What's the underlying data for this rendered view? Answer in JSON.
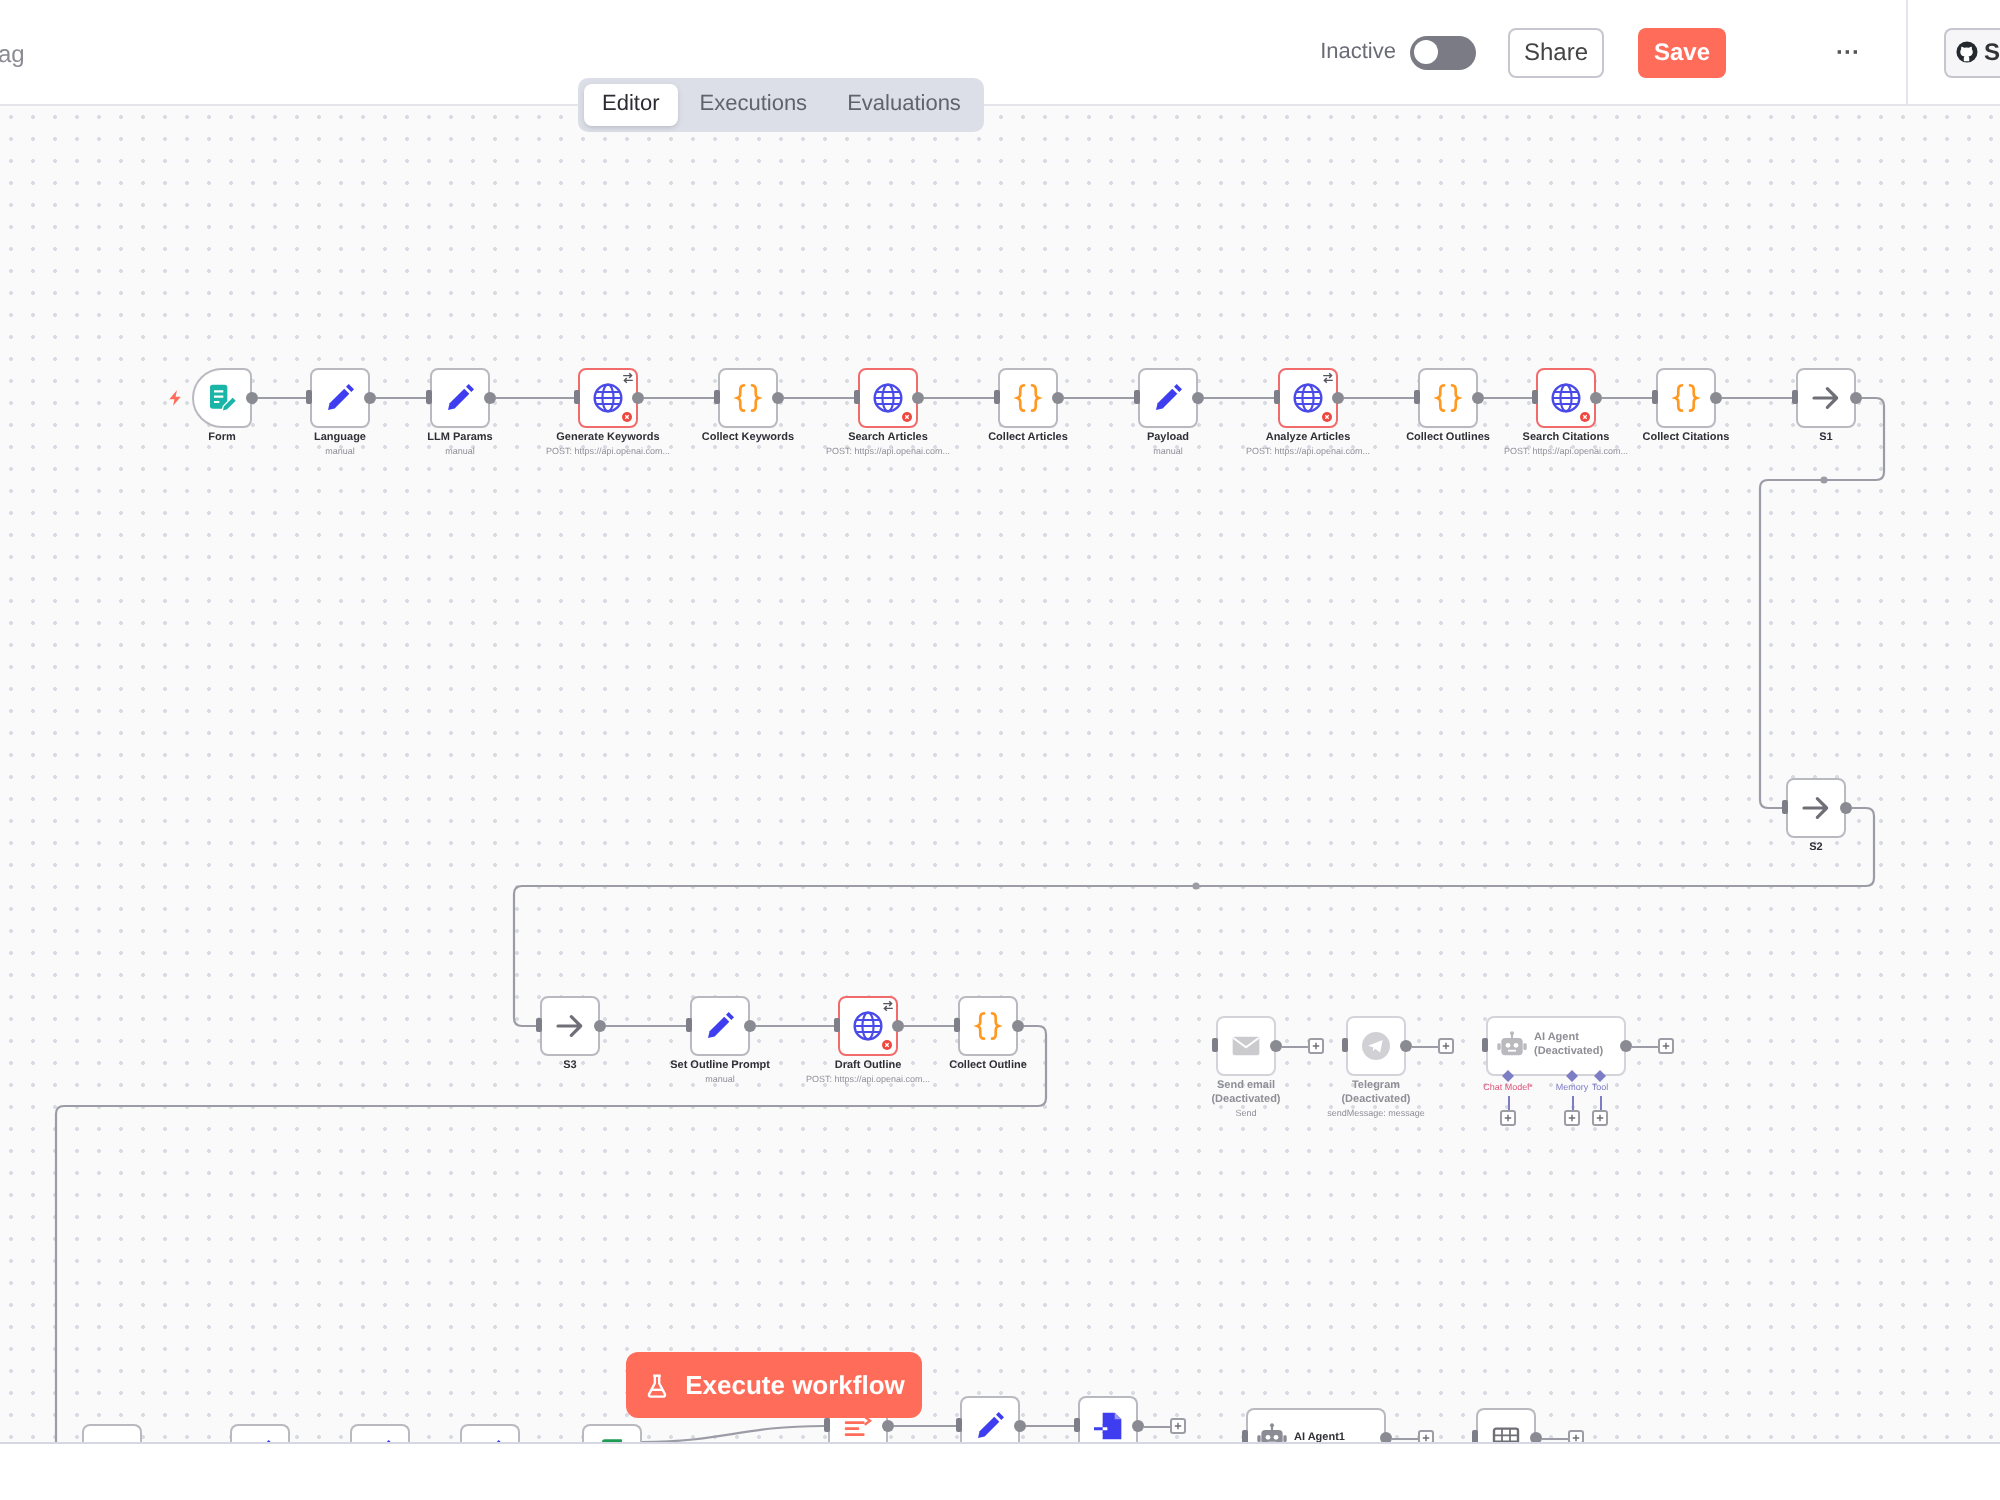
{
  "header": {
    "tag_text": "ag",
    "status_label": "Inactive",
    "active": false,
    "share_label": "Share",
    "save_label": "Save",
    "more_label": "···",
    "repo_label": "S"
  },
  "view_tabs": [
    {
      "label": "Editor",
      "selected": true
    },
    {
      "label": "Executions",
      "selected": false
    },
    {
      "label": "Evaluations",
      "selected": false
    }
  ],
  "nodes": [
    {
      "kind": "form",
      "title": "Form",
      "issues": false,
      "badge": false,
      "disabled": false
    },
    {
      "kind": "set",
      "title": "Language",
      "subtitle": "manual",
      "issues": false,
      "badge": false,
      "disabled": false
    },
    {
      "kind": "set",
      "title": "LLM Params",
      "subtitle": "manual",
      "issues": false,
      "badge": false,
      "disabled": false
    },
    {
      "kind": "http",
      "title": "Generate Keywords",
      "subtitle": "POST: https://api.openai.com...",
      "issues": true,
      "badge": true,
      "disabled": false
    },
    {
      "kind": "code",
      "title": "Collect Keywords",
      "issues": false,
      "badge": false,
      "disabled": false
    },
    {
      "kind": "http",
      "title": "Search Articles",
      "subtitle": "POST: https://api.openai.com...",
      "issues": true,
      "badge": false,
      "disabled": false
    },
    {
      "kind": "code",
      "title": "Collect Articles",
      "issues": false,
      "badge": false,
      "disabled": false
    },
    {
      "kind": "set",
      "title": "Payload",
      "subtitle": "manual",
      "issues": false,
      "badge": false,
      "disabled": false
    },
    {
      "kind": "http",
      "title": "Analyze Articles",
      "subtitle": "POST: https://api.openai.com...",
      "issues": true,
      "badge": true,
      "disabled": false
    },
    {
      "kind": "code",
      "title": "Collect Outlines",
      "issues": false,
      "badge": false,
      "disabled": false
    },
    {
      "kind": "http",
      "title": "Search Citations",
      "subtitle": "POST: https://api.openai.com...",
      "issues": true,
      "badge": false,
      "disabled": false
    },
    {
      "kind": "code",
      "title": "Collect Citations",
      "issues": false,
      "badge": false,
      "disabled": false
    },
    {
      "kind": "noop",
      "title": "S1",
      "issues": false,
      "badge": false,
      "disabled": false
    },
    {
      "kind": "noop",
      "title": "S2",
      "issues": false,
      "badge": false,
      "disabled": false
    },
    {
      "kind": "noop",
      "title": "S3",
      "issues": false,
      "badge": false,
      "disabled": false
    },
    {
      "kind": "set",
      "title": "Set Outline Prompt",
      "subtitle": "manual",
      "issues": false,
      "badge": false,
      "disabled": false
    },
    {
      "kind": "http",
      "title": "Draft Outline",
      "subtitle": "POST: https://api.openai.com...",
      "issues": true,
      "badge": true,
      "disabled": false
    },
    {
      "kind": "code",
      "title": "Collect Outline",
      "issues": false,
      "badge": false,
      "disabled": false
    },
    {
      "kind": "email",
      "title": "Send email",
      "note": "(Deactivated)",
      "subtitle": "Send",
      "issues": false,
      "badge": false,
      "disabled": true
    },
    {
      "kind": "telegram",
      "title": "Telegram",
      "note": "(Deactivated)",
      "subtitle": "sendMessage: message",
      "issues": false,
      "badge": false,
      "disabled": true
    },
    {
      "kind": "agent",
      "title": "AI Agent",
      "note": "(Deactivated)",
      "issues": false,
      "badge": false,
      "disabled": true,
      "sub_inputs": [
        {
          "label": "Chat Model*",
          "required": true
        },
        {
          "label": "Memory",
          "required": false
        },
        {
          "label": "Tool",
          "required": false
        }
      ]
    },
    {
      "issues": false,
      "badge": false,
      "disabled": false
    },
    {
      "kind": "set",
      "issues": false,
      "badge": false,
      "disabled": false
    },
    {
      "kind": "set",
      "issues": false,
      "badge": false,
      "disabled": false
    },
    {
      "kind": "set",
      "issues": false,
      "badge": false,
      "disabled": false
    },
    {
      "kind": "sheet",
      "issues": false,
      "badge": false,
      "disabled": false
    },
    {
      "kind": "list",
      "issues": false,
      "disabled": false
    },
    {
      "kind": "set",
      "issues": false,
      "badge": false,
      "disabled": false
    },
    {
      "kind": "file",
      "issues": false,
      "badge": false,
      "disabled": false
    },
    {
      "kind": "agent",
      "title": "AI Agent1",
      "issues": false,
      "badge": false,
      "disabled": false
    },
    {
      "kind": "grid",
      "issues": false,
      "badge": false,
      "disabled": false
    }
  ],
  "execute_button": {
    "label": "Execute workflow"
  }
}
